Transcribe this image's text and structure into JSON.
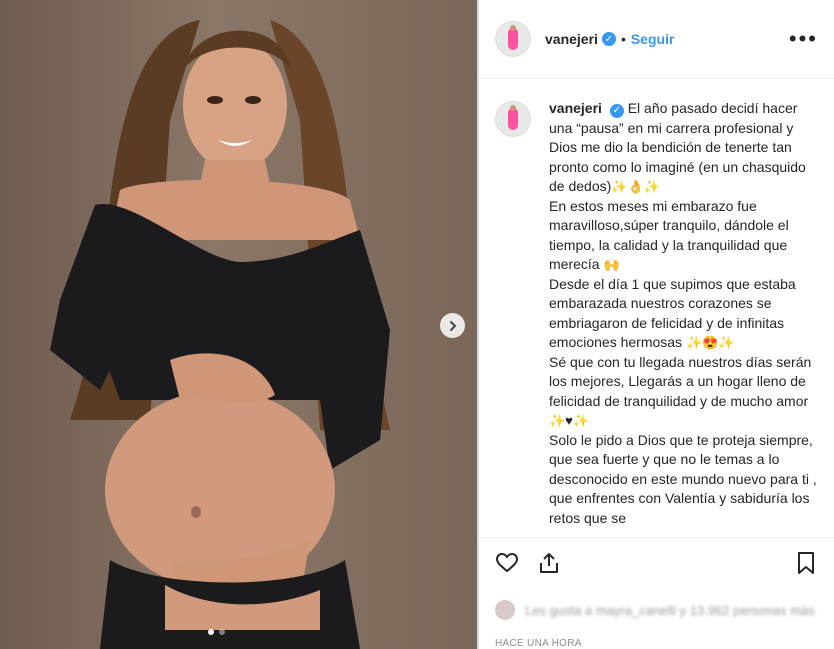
{
  "header": {
    "username": "vanejeri",
    "follow_label": "Seguir",
    "more_label": "•••"
  },
  "caption": {
    "username": "vanejeri",
    "text_1": "El año pasado decidí hacer una “pausa” en mi carrera profesional y Dios me dio la bendición de tenerte tan pronto como lo imaginé (en un chasquido de dedos)",
    "emoji_1": "✨👌✨",
    "text_2": "En estos meses mi embarazo fue maravilloso,súper tranquilo, dándole el tiempo, la calidad y la tranquilidad que merecía",
    "emoji_2": "🙌",
    "text_3": "Desde el día 1 que supimos que estaba embarazada nuestros corazones se embriagaron de felicidad y de infinitas emociones hermosas",
    "emoji_3": "✨😍✨",
    "text_4": "Sé que con tu llegada nuestros días serán los mejores, Llegarás a un hogar lleno de felicidad de tranquilidad y de mucho amor",
    "emoji_4": "✨♥✨",
    "text_5": "Solo le pido a Dios que te proteja siempre, que sea fuerte y que no le temas a lo desconocido en este mundo nuevo para ti , que enfrentes con Valentía y sabiduría los retos que se"
  },
  "likes": {
    "text": "Les gusta a mayra_canelli y 13.962 personas más"
  },
  "timestamp": "HACE UNA HORA",
  "colors": {
    "link": "#3897f0",
    "text": "#262626",
    "muted": "#8e8e8e"
  },
  "icons": [
    "heart-icon",
    "share-icon",
    "bookmark-icon",
    "chevron-right-icon",
    "verified-badge-icon",
    "more-options-icon"
  ]
}
